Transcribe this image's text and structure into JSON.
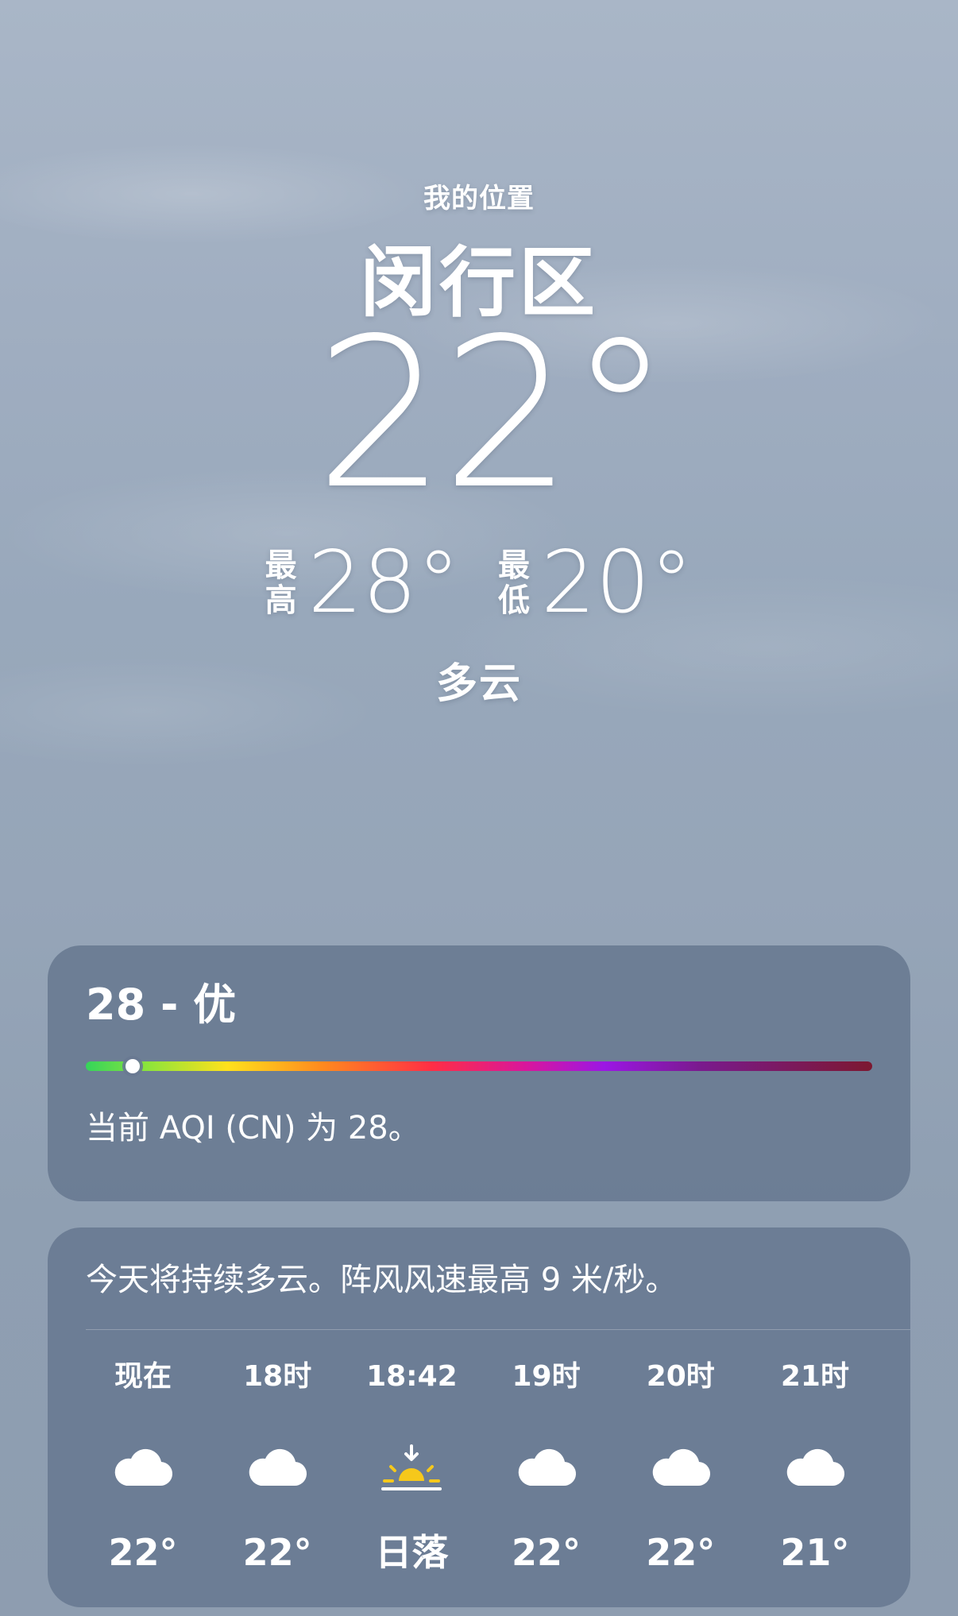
{
  "location": {
    "label": "我的位置",
    "city": "闵行区"
  },
  "current": {
    "temperature": "22°",
    "high_label_top": "最",
    "high_label_bottom": "高",
    "high": "28°",
    "low_label_top": "最",
    "low_label_bottom": "低",
    "low": "20°",
    "condition": "多云"
  },
  "aqi": {
    "title": "28 - 优",
    "value": 28,
    "scale_fraction": 0.06,
    "description": "当前 AQI (CN) 为 28。"
  },
  "forecast": {
    "summary": "今天将持续多云。阵风风速最高 9 米/秒。",
    "hours": [
      {
        "label": "现在",
        "icon": "cloud-icon",
        "value": "22°"
      },
      {
        "label": "18时",
        "icon": "cloud-icon",
        "value": "22°"
      },
      {
        "label": "18:42",
        "icon": "sunset-icon",
        "value": "日落"
      },
      {
        "label": "19时",
        "icon": "cloud-icon",
        "value": "22°"
      },
      {
        "label": "20时",
        "icon": "cloud-icon",
        "value": "22°"
      },
      {
        "label": "21时",
        "icon": "cloud-icon",
        "value": "21°"
      }
    ]
  },
  "colors": {
    "card_bg": "#687991",
    "sunset_yellow": "#f6c81b"
  }
}
